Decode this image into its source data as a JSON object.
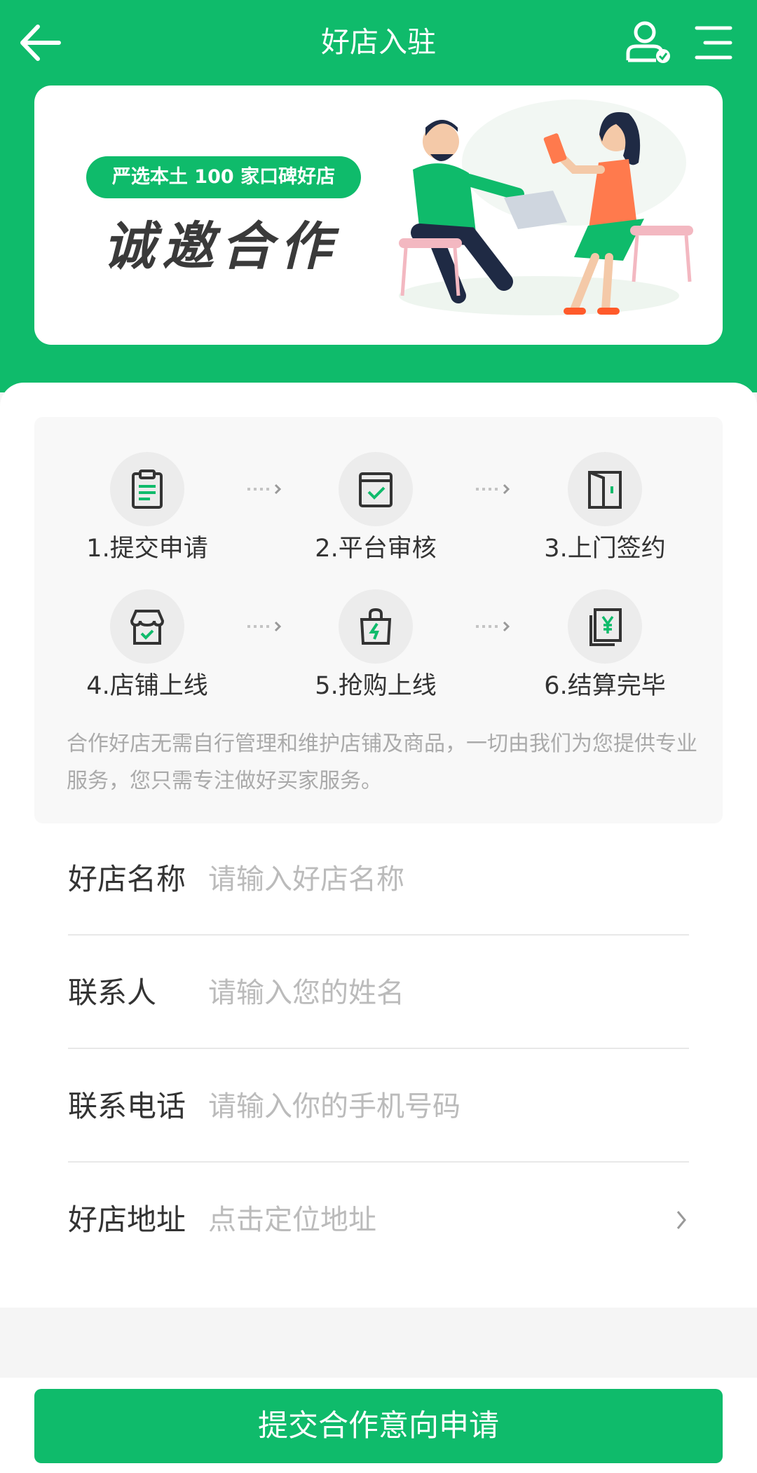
{
  "nav": {
    "title": "好店入驻",
    "back_icon": "arrow-left-icon",
    "user_icon": "user-verified-icon",
    "menu_icon": "menu-icon"
  },
  "banner": {
    "pill_text": "严选本土 100 家口碑好店",
    "slogan": "诚邀合作"
  },
  "process": {
    "steps": [
      {
        "label": "1.提交申请",
        "icon": "clipboard-icon"
      },
      {
        "label": "2.平台审核",
        "icon": "review-check-icon"
      },
      {
        "label": "3.上门签约",
        "icon": "door-icon"
      },
      {
        "label": "4.店铺上线",
        "icon": "store-icon"
      },
      {
        "label": "5.抢购上线",
        "icon": "shopping-bag-icon"
      },
      {
        "label": "6.结算完毕",
        "icon": "yen-document-icon"
      }
    ],
    "note": "合作好店无需自行管理和维护店铺及商品，一切由我们为您提供专业服务，您只需专注做好买家服务。"
  },
  "form": {
    "fields": [
      {
        "label": "好店名称",
        "placeholder": "请输入好店名称"
      },
      {
        "label": "联系人",
        "placeholder": "请输入您的姓名"
      },
      {
        "label": "联系电话",
        "placeholder": "请输入你的手机号码"
      },
      {
        "label": "好店地址",
        "placeholder": "点击定位地址"
      }
    ]
  },
  "submit_label": "提交合作意向申请",
  "colors": {
    "accent": "#0fbb6b",
    "text": "#333333",
    "placeholder": "#bbbbbb"
  }
}
